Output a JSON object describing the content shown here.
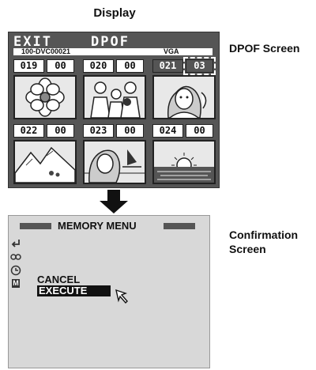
{
  "heading": "Display",
  "labels": {
    "dpof_screen": "DPOF Screen",
    "confirmation_line1": "Confirmation",
    "confirmation_line2": "Screen"
  },
  "dpof": {
    "exit_label": "EXIT",
    "title": "DPOF",
    "folder": "100-DVC00021",
    "resolution": "VGA",
    "cells": [
      {
        "number": "019",
        "quantity": "00",
        "picture": "flower"
      },
      {
        "number": "020",
        "quantity": "00",
        "picture": "family"
      },
      {
        "number": "021",
        "quantity": "03",
        "picture": "woman-portrait",
        "selected": true
      },
      {
        "number": "022",
        "quantity": "00",
        "picture": "mountains"
      },
      {
        "number": "023",
        "quantity": "00",
        "picture": "woman-beach"
      },
      {
        "number": "024",
        "quantity": "00",
        "picture": "sunset"
      }
    ]
  },
  "menu": {
    "title": "MEMORY MENU",
    "mode_icon": "M",
    "options": [
      "CANCEL",
      "EXECUTE"
    ],
    "selected_option": "EXECUTE"
  }
}
